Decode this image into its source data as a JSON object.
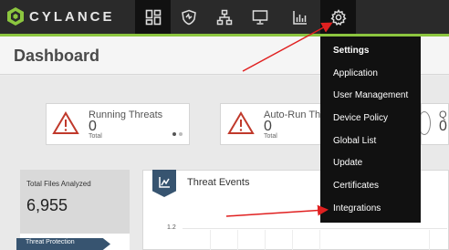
{
  "app": {
    "brand": "CYLANCE"
  },
  "nav": {
    "items": [
      {
        "icon": "dashboard-icon",
        "active": true
      },
      {
        "icon": "shield-icon"
      },
      {
        "icon": "zones-network-icon"
      },
      {
        "icon": "devices-monitor-icon"
      },
      {
        "icon": "reports-chart-icon"
      },
      {
        "icon": "gear-icon",
        "open": true
      }
    ]
  },
  "page": {
    "title": "Dashboard"
  },
  "cards": {
    "running": {
      "title": "Running Threats",
      "count": "0",
      "sub": "Total"
    },
    "autorun": {
      "title": "Auto-Run Thr",
      "count": "0",
      "sub": "Total"
    },
    "third": {
      "title": "Q",
      "count": "0"
    }
  },
  "files": {
    "label": "Total Files Analyzed",
    "count": "6,955"
  },
  "threat_protection": {
    "label": "Threat Protection"
  },
  "threat_events": {
    "title": "Threat Events",
    "y_tick": "1.2"
  },
  "settings_menu": {
    "header": "Settings",
    "items": [
      "Application",
      "User Management",
      "Device Policy",
      "Global List",
      "Update",
      "Certificates",
      "Integrations"
    ]
  },
  "colors": {
    "accent_green": "#8cc63f",
    "nav_bg": "#2a2a2a",
    "menu_bg": "#111111",
    "tag_blue": "#375470",
    "annotation_red": "#e02020",
    "warning_red": "#c0392b"
  }
}
